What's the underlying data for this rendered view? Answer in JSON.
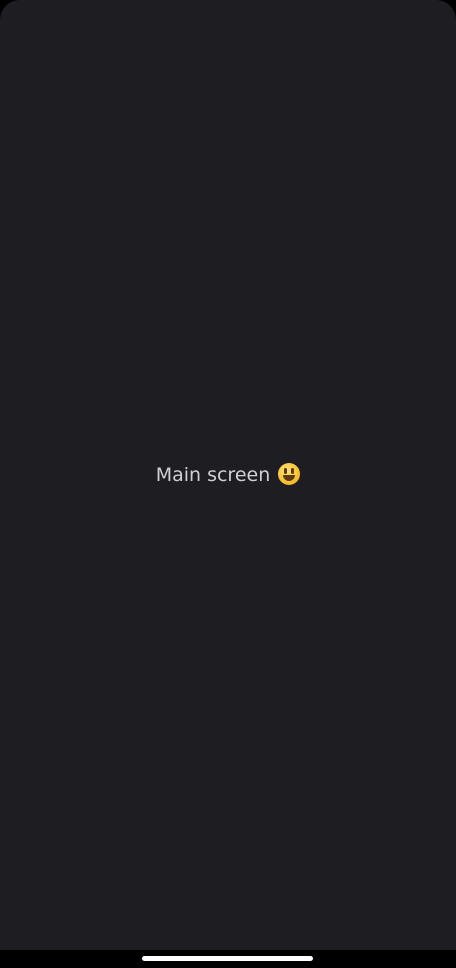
{
  "main": {
    "label": "Main screen",
    "emoji_icon": "smiley-face-icon"
  },
  "colors": {
    "background": "#1e1e22",
    "text": "#cfcfd4",
    "system_bar": "#000000",
    "home_indicator": "#ffffff"
  }
}
